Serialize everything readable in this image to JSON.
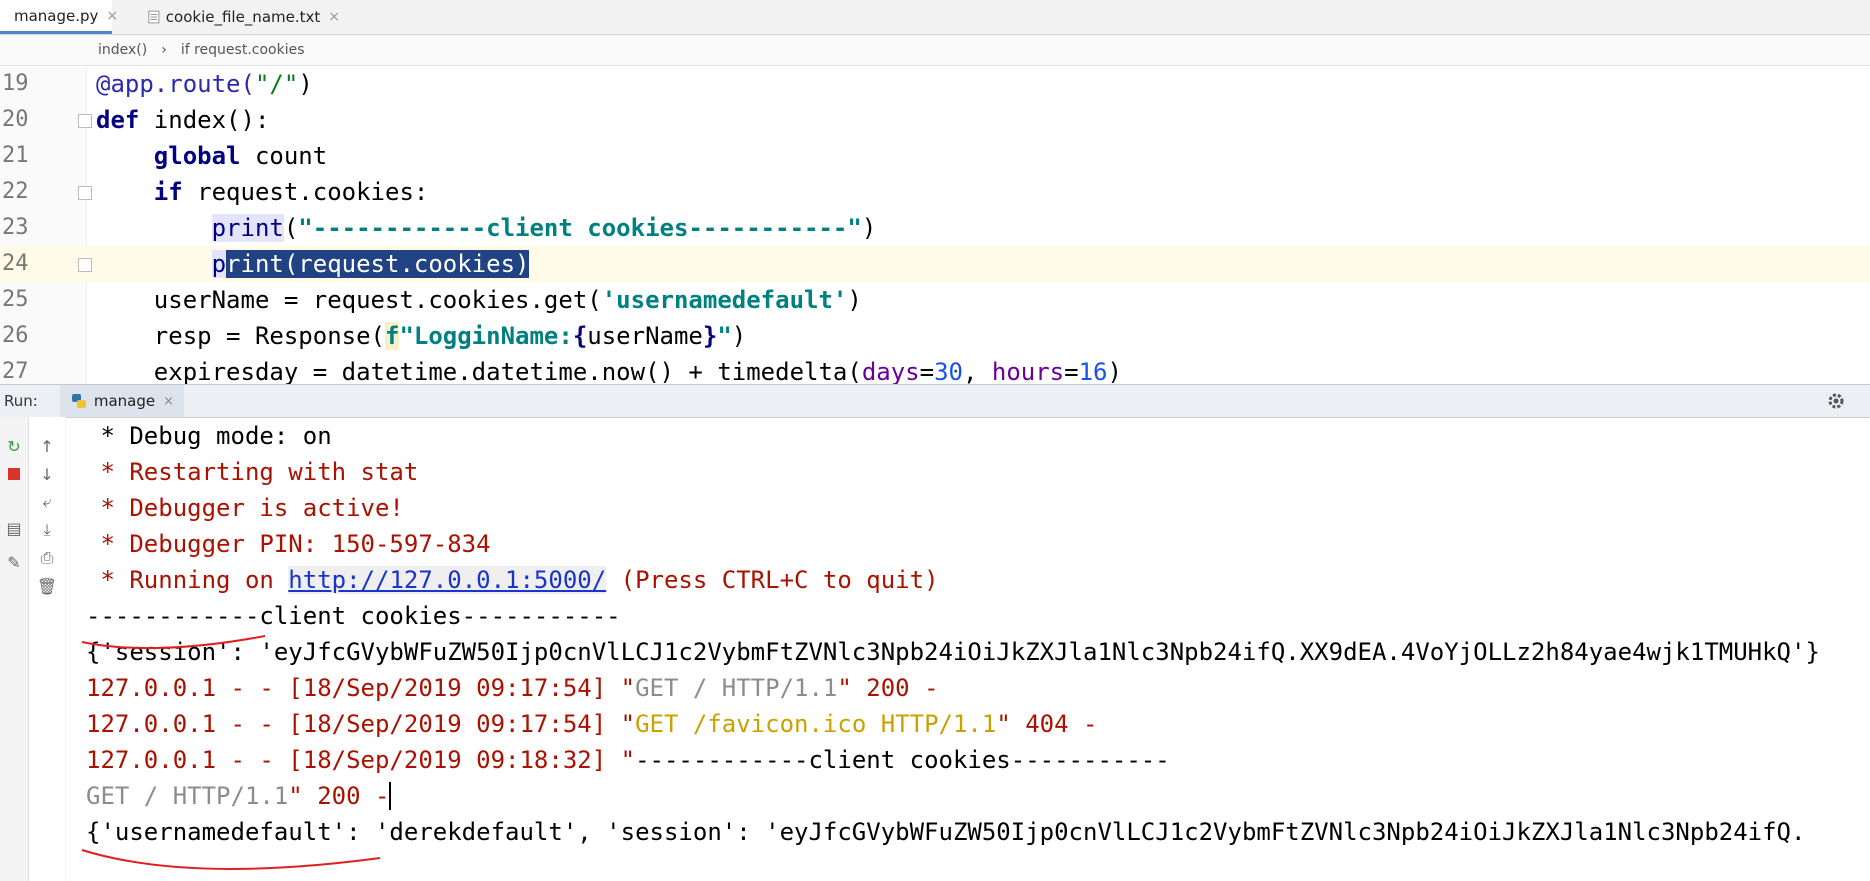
{
  "tabs": [
    {
      "label": "manage.py",
      "icon": "python-file-icon",
      "active": true
    },
    {
      "label": "cookie_file_name.txt",
      "icon": "text-file-icon",
      "active": false
    }
  ],
  "breadcrumb": {
    "items": [
      "index()",
      "›",
      "if request.cookies"
    ]
  },
  "editor": {
    "lines": [
      {
        "num": "19"
      },
      {
        "num": "20"
      },
      {
        "num": "21"
      },
      {
        "num": "22"
      },
      {
        "num": "23"
      },
      {
        "num": "24"
      },
      {
        "num": "25"
      },
      {
        "num": "26"
      },
      {
        "num": "27"
      }
    ],
    "code": {
      "l19_dec": "@app.route(",
      "l19_str": "\"/\"",
      "l19_end": ")",
      "l20_kw": "def",
      "l20_rest": " index():",
      "l21_kw": "global",
      "l21_rest": " count",
      "l22_kw": "if",
      "l22_rest": " request.cookies:",
      "l23_pr": "print",
      "l23_open": "(",
      "l23_str": "\"------------client cookies-----------\"",
      "l23_close": ")",
      "l24_p": "p",
      "l24_sel": "rint(request.cookies)",
      "l25_a": "userName = request.cookies.get(",
      "l25_str": "'usernamedefault'",
      "l25_b": ")",
      "l26_a": "resp = Response(",
      "l26_f": "f",
      "l26_str1": "\"LogginName:",
      "l26_brace1": "{",
      "l26_var": "userName",
      "l26_brace2": "}",
      "l26_str2": "\"",
      "l26_b": ")",
      "l27_a": "expiresday = datetime.datetime.now() + timedelta(",
      "l27_k1": "days",
      "l27_eq1": "=",
      "l27_n1": "30",
      "l27_c": ", ",
      "l27_k2": "hours",
      "l27_eq2": "=",
      "l27_n2": "16",
      "l27_b": ")"
    }
  },
  "run": {
    "label": "Run:",
    "tab_label": "manage",
    "close": "×"
  },
  "console": {
    "l1": " * Debug mode: on",
    "l2": " * Restarting with stat",
    "l3": " * Debugger is active!",
    "l4": " * Debugger PIN: 150-597-834",
    "l5_a": " * Running on ",
    "l5_link": "http://127.0.0.1:5000/",
    "l5_b": " (Press CTRL+C to quit)",
    "l6": "------------client cookies-----------",
    "l7": "{'session': 'eyJfcGVybWFuZW50Ijp0cnVlLCJ1c2VybmFtZVNlc3Npb24iOiJkZXJla1Nlc3Npb24ifQ.XX9dEA.4VoYjOLLz2h84yae4wjk1TMUHkQ'}",
    "l8_a": "127.0.0.1 - - [18/Sep/2019 09:17:54] \"",
    "l8_b": "GET / HTTP/1.1",
    "l8_c": "\" 200 -",
    "l9_a": "127.0.0.1 - - [18/Sep/2019 09:17:54] \"",
    "l9_b": "GET /favicon.ico HTTP/1.1",
    "l9_c": "\" 404 -",
    "l10_a": "127.0.0.1 - - [18/Sep/2019 09:18:32] \"",
    "l10_b": "------------client cookies-----------",
    "l11_a": "GET / HTTP/1.1",
    "l11_b": "\" 200 -",
    "l12": "{'usernamedefault': 'derekdefault', 'session': 'eyJfcGVybWFuZW50Ijp0cnVlLCJ1c2VybmFtZVNlc3Npb24iOiJkZXJla1Nlc3Npb24ifQ."
  },
  "colors": {
    "annotation": "#e02020",
    "selection": "#214283",
    "accent": "#4a88c7"
  }
}
